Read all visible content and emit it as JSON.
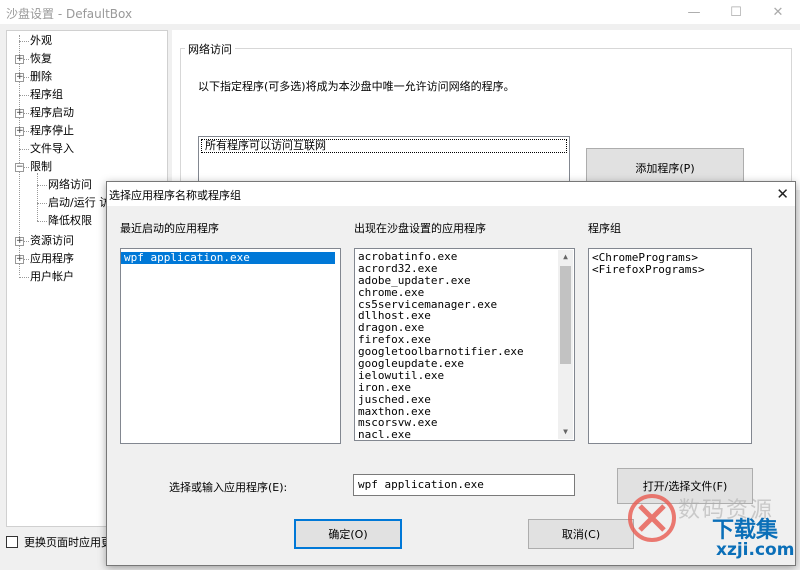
{
  "window": {
    "title": "沙盘设置 - DefaultBox",
    "minimize_glyph": "—",
    "maximize_glyph": "☐",
    "close_glyph": "✕"
  },
  "tree": {
    "items": [
      {
        "label": "外观",
        "expander": ""
      },
      {
        "label": "恢复",
        "expander": "+"
      },
      {
        "label": "删除",
        "expander": "+"
      },
      {
        "label": "程序组",
        "expander": ""
      },
      {
        "label": "程序启动",
        "expander": "+"
      },
      {
        "label": "程序停止",
        "expander": "+"
      },
      {
        "label": "文件导入",
        "expander": ""
      },
      {
        "label": "限制",
        "expander": "−"
      },
      {
        "label": "网络访问",
        "expander": ""
      },
      {
        "label": "启动/运行 访",
        "expander": ""
      },
      {
        "label": "降低权限",
        "expander": ""
      },
      {
        "label": "资源访问",
        "expander": "+"
      },
      {
        "label": "应用程序",
        "expander": "+"
      },
      {
        "label": "用户帐户",
        "expander": ""
      }
    ]
  },
  "network_access": {
    "group_title": "网络访问",
    "description": "以下指定程序(可多选)将成为本沙盘中唯一允许访问网络的程序。",
    "list_item": "所有程序可以访问互联网",
    "add_button": "添加程序(P)"
  },
  "bottom_checkbox": {
    "label": "更换页面时应用更"
  },
  "dialog": {
    "title": "选择应用程序名称或程序组",
    "close_glyph": "✕",
    "recent": {
      "label": "最近启动的应用程序",
      "items": [
        "wpf application.exe"
      ]
    },
    "sandbox": {
      "label": "出现在沙盘设置的应用程序",
      "items": [
        "acrobatinfo.exe",
        "acrord32.exe",
        "adobe_updater.exe",
        "chrome.exe",
        "cs5servicemanager.exe",
        "dllhost.exe",
        "dragon.exe",
        "firefox.exe",
        "googletoolbarnotifier.exe",
        "googleupdate.exe",
        "ielowutil.exe",
        "iron.exe",
        "jusched.exe",
        "maxthon.exe",
        "mscorsvw.exe",
        "nacl.exe"
      ],
      "scroll_up": "▲",
      "scroll_down": "▼"
    },
    "groups": {
      "label": "程序组",
      "items": [
        "<ChromePrograms>",
        "<FirefoxPrograms>"
      ]
    },
    "input_label": "选择或输入应用程序(E):",
    "input_value": "wpf application.exe",
    "open_button": "打开/选择文件(F)",
    "ok_button": "确定(O)",
    "cancel_button": "取消(C)"
  },
  "watermark": {
    "line1": "数码资源",
    "line2": "下载集",
    "line3": "xzji.com"
  },
  "colors": {
    "selection": "#0078d7",
    "watermark_blue": "#0b6fb8",
    "watermark_red": "#e85a50"
  }
}
